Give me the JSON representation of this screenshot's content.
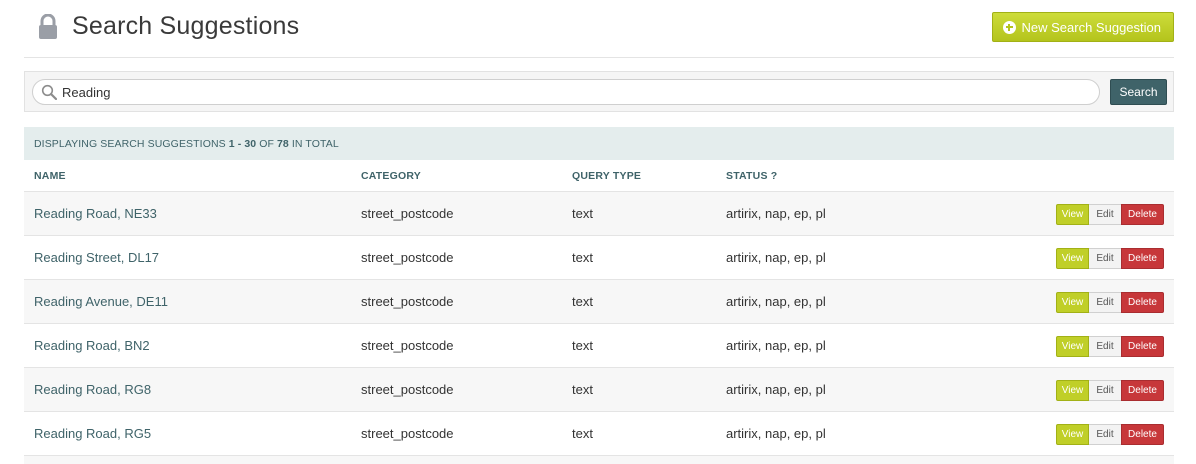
{
  "header": {
    "title": "Search Suggestions",
    "icon": "lock-icon",
    "new_button_label": "New Search Suggestion"
  },
  "search": {
    "value": "Reading",
    "button_label": "Search"
  },
  "summary": {
    "prefix": "DISPLAYING SEARCH SUGGESTIONS",
    "range": "1 - 30",
    "of": "OF",
    "total": "78",
    "suffix": "IN TOTAL"
  },
  "table": {
    "columns": [
      "NAME",
      "CATEGORY",
      "QUERY TYPE",
      "STATUS ?"
    ],
    "rows": [
      {
        "name": "Reading Road, NE33",
        "category": "street_postcode",
        "query_type": "text",
        "status": "artirix, nap, ep, pl"
      },
      {
        "name": "Reading Street, DL17",
        "category": "street_postcode",
        "query_type": "text",
        "status": "artirix, nap, ep, pl"
      },
      {
        "name": "Reading Avenue, DE11",
        "category": "street_postcode",
        "query_type": "text",
        "status": "artirix, nap, ep, pl"
      },
      {
        "name": "Reading Road, BN2",
        "category": "street_postcode",
        "query_type": "text",
        "status": "artirix, nap, ep, pl"
      },
      {
        "name": "Reading Road, RG8",
        "category": "street_postcode",
        "query_type": "text",
        "status": "artirix, nap, ep, pl"
      },
      {
        "name": "Reading Road, RG5",
        "category": "street_postcode",
        "query_type": "text",
        "status": "artirix, nap, ep, pl"
      }
    ],
    "actions": {
      "view": "View",
      "edit": "Edit",
      "delete": "Delete"
    }
  },
  "colors": {
    "accent_green": "#c0cf28",
    "teal": "#3f6369",
    "danger": "#c7373a",
    "summary_bg": "#e4eded"
  }
}
